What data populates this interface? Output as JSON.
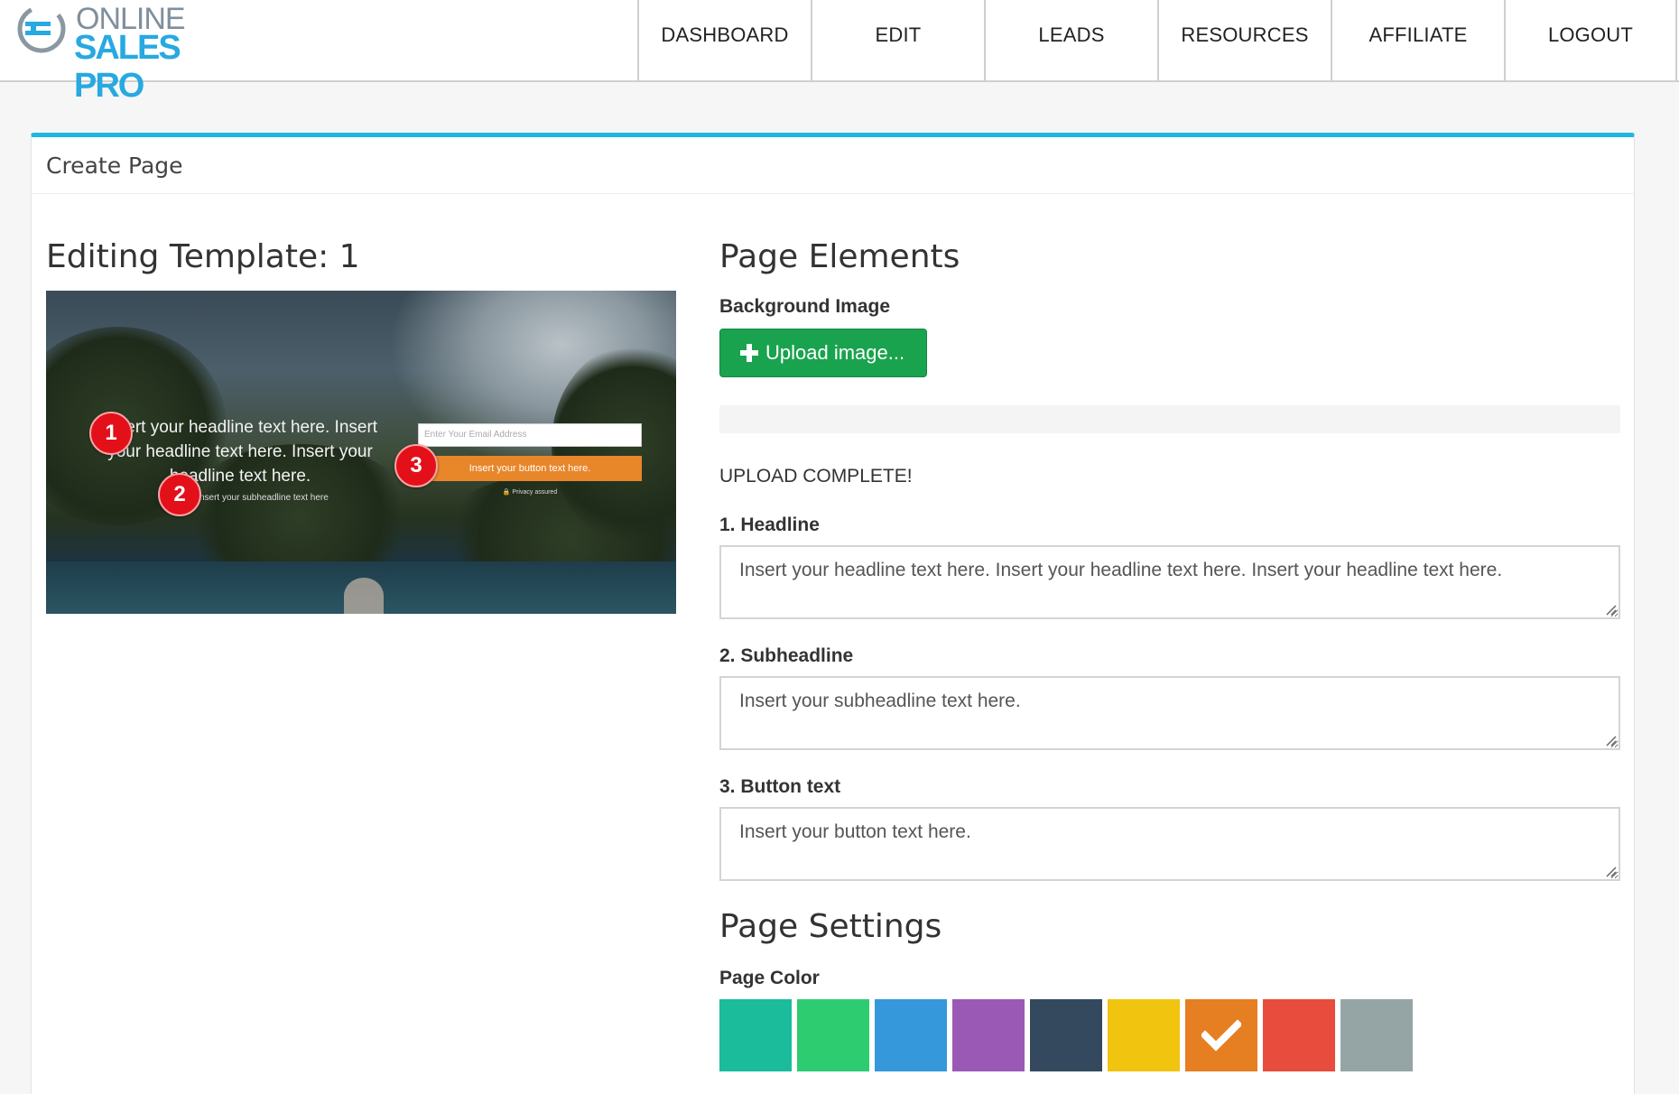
{
  "brand": {
    "line1": "ONLINE",
    "line2": "SALES PRO"
  },
  "nav": {
    "items": [
      {
        "label": "DASHBOARD"
      },
      {
        "label": "EDIT"
      },
      {
        "label": "LEADS"
      },
      {
        "label": "RESOURCES"
      },
      {
        "label": "AFFILIATE"
      },
      {
        "label": "LOGOUT"
      }
    ]
  },
  "panel": {
    "title": "Create Page"
  },
  "template": {
    "title": "Editing Template: 1",
    "preview": {
      "headline": "Insert your headline text here. Insert your headline text here. Insert your headline text here.",
      "subheadline": "Insert your subheadline text here",
      "email_placeholder": "Enter Your Email Address",
      "button": "Insert your button text here.",
      "privacy": "🔒 Privacy assured",
      "markers": [
        "1",
        "2",
        "3"
      ]
    }
  },
  "elements": {
    "title": "Page Elements",
    "background_label": "Background Image",
    "upload_button": "Upload image...",
    "upload_status": "UPLOAD COMPLETE!",
    "upload_progress": 0,
    "fields": [
      {
        "label": "1. Headline",
        "value": "Insert your headline text here. Insert your headline text here. Insert your headline text here."
      },
      {
        "label": "2. Subheadline",
        "value": "Insert your subheadline text here."
      },
      {
        "label": "3. Button text",
        "value": "Insert your button text here."
      }
    ]
  },
  "settings": {
    "title": "Page Settings",
    "color_label": "Page Color",
    "colors": [
      "#1abc9c",
      "#2ecc71",
      "#3498db",
      "#9b59b6",
      "#34495e",
      "#f1c40f",
      "#e67e22",
      "#e74c3c",
      "#95a5a6"
    ],
    "selected_color": "#e67e22"
  },
  "icons": {
    "upload": "plus-icon",
    "selected": "checkmark-icon",
    "logo": "logo-mark-icon"
  }
}
